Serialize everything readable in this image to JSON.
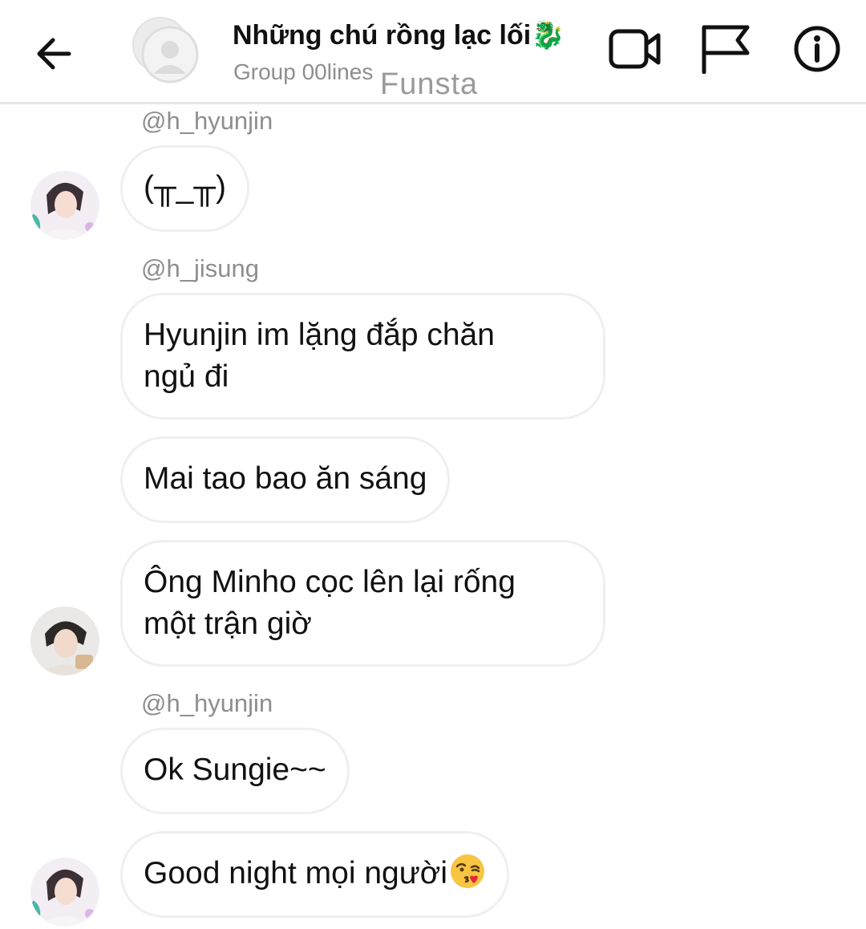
{
  "header": {
    "back_icon": "arrow-left-icon",
    "title": "Những chú rồng lạc lối🐉",
    "subtitle": "Group 00lines",
    "watermark": "Funsta",
    "video_icon": "video-camera-icon",
    "flag_icon": "flag-icon",
    "info_icon": "info-icon"
  },
  "messages": [
    {
      "username": "@h_hyunjin",
      "text": "(╥_╥)"
    },
    {
      "username": "@h_jisung",
      "text_line1": "Hyunjin im lặng đắp chăn",
      "text_line2": "ngủ đi"
    },
    {
      "text": "Mai tao bao ăn sáng"
    },
    {
      "text_line1": "Ông Minho cọc lên lại rống",
      "text_line2": "một trận giờ"
    },
    {
      "username": "@h_hyunjin",
      "text": "Ok Sungie~~"
    },
    {
      "text": "Good night mọi người",
      "emoji": "kissing-face-emoji"
    }
  ],
  "colors": {
    "bubble_border": "#efefef",
    "meta_text": "#8e8e8e",
    "header_divider": "#e6e6e6"
  }
}
